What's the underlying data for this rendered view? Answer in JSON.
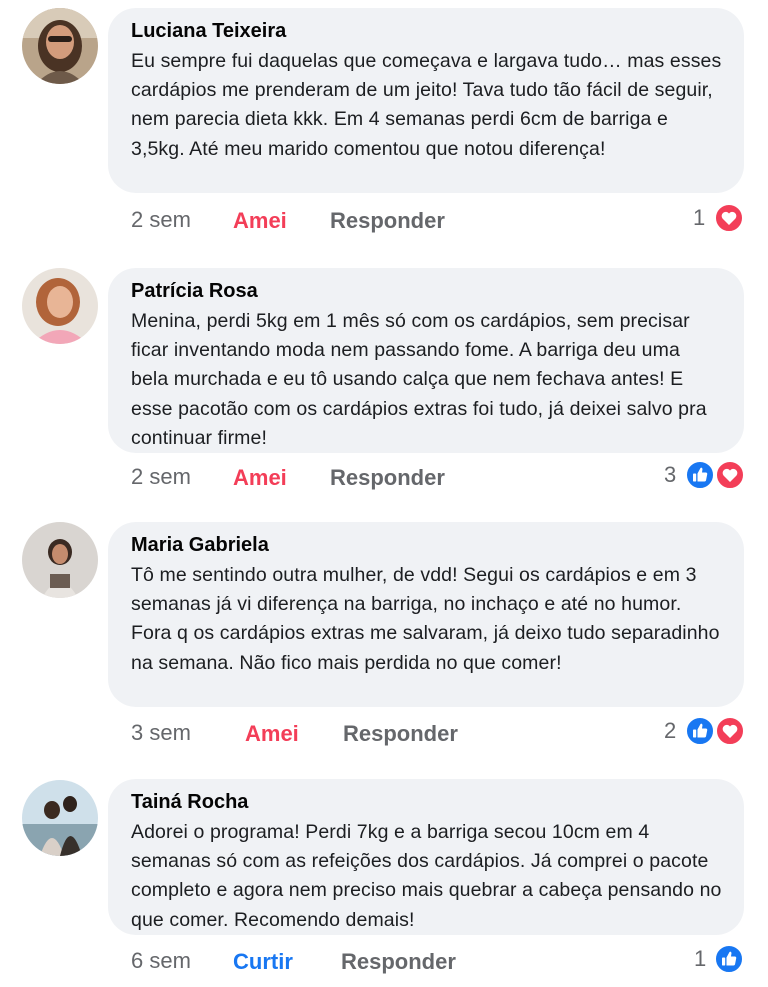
{
  "comments": [
    {
      "name": "Luciana Teixeira",
      "text": "Eu sempre fui daquelas que começava e largava tudo… mas esses cardápios me prenderam de um jeito! Tava tudo tão fácil de seguir, nem parecia dieta kkk. Em 4 semanas perdi 6cm de barriga e 3,5kg. Até meu marido comentou que notou diferença!",
      "time": "2 sem",
      "reaction_label": "Amei",
      "reply_label": "Responder",
      "reaction_count": "1",
      "reaction_icons": [
        "heart-icon"
      ]
    },
    {
      "name": "Patrícia Rosa",
      "text": "Menina, perdi 5kg em 1 mês só com os cardápios, sem precisar ficar inventando moda nem passando fome. A barriga deu uma bela murchada e eu tô usando calça que nem fechava antes! E esse pacotão com os cardápios extras foi tudo, já deixei salvo pra continuar firme!",
      "time": "2 sem",
      "reaction_label": "Amei",
      "reply_label": "Responder",
      "reaction_count": "3",
      "reaction_icons": [
        "like-icon",
        "heart-icon"
      ]
    },
    {
      "name": "Maria Gabriela",
      "text": "Tô me sentindo outra mulher, de vdd! Segui os cardápios e em 3 semanas já vi diferença na barriga, no inchaço e até no humor. Fora q os cardápios extras me salvaram, já deixo tudo separadinho na semana. Não fico mais perdida no que comer!",
      "time": "3 sem",
      "reaction_label": "Amei",
      "reply_label": "Responder",
      "reaction_count": "2",
      "reaction_icons": [
        "like-icon",
        "heart-icon"
      ]
    },
    {
      "name": "Tainá Rocha",
      "text": "Adorei o programa! Perdi 7kg e a barriga secou 10cm em 4 semanas só com as refeições dos cardápios. Já comprei o pacote completo e agora nem preciso mais quebrar a cabeça pensando no que comer. Recomendo demais!",
      "time": "6 sem",
      "reaction_label": "Curtir",
      "reply_label": "Responder",
      "reaction_count": "1",
      "reaction_icons": [
        "like-icon"
      ]
    }
  ],
  "colors": {
    "bubble": "#f0f2f5",
    "love": "#f33e58",
    "like": "#1877f2",
    "muted": "#65676b"
  }
}
